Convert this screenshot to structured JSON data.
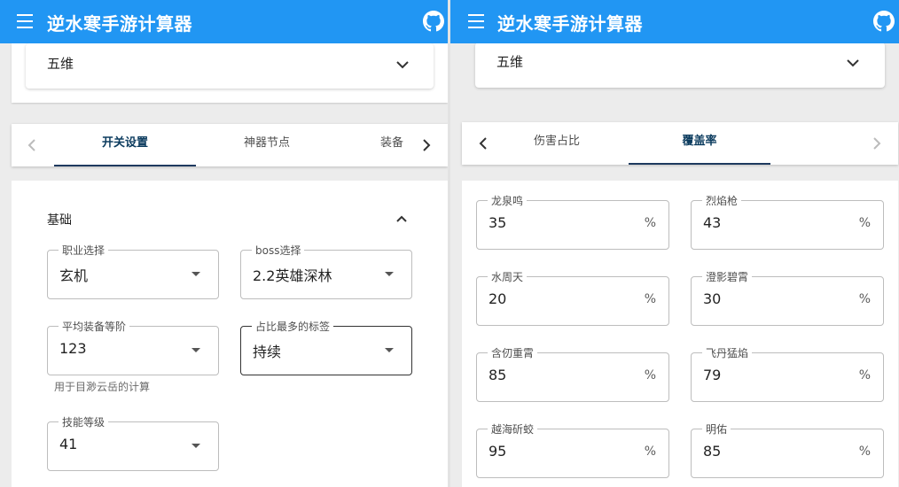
{
  "app": {
    "title": "逆水寒手游计算器"
  },
  "icons": {
    "menu": "menu-icon",
    "github": "github-icon",
    "chevron_down": "chevron-down-icon",
    "chevron_up": "chevron-up-icon",
    "chevron_left": "chevron-left-icon",
    "chevron_right": "chevron-right-icon",
    "dropdown": "dropdown-arrow-icon"
  },
  "colors": {
    "appbar": "#2196f3",
    "tab_active": "#0b3b5e"
  },
  "left": {
    "top_select": {
      "value": "五维"
    },
    "tabs": [
      {
        "label": "开关设置"
      },
      {
        "label": "神器节点"
      },
      {
        "label": "装备"
      }
    ],
    "section_title": "基础",
    "fields": {
      "profession": {
        "label": "职业选择",
        "value": "玄机"
      },
      "boss": {
        "label": "boss选择",
        "value": "2.2英雄深林"
      },
      "avg_gear": {
        "label": "平均装备等阶",
        "value": "123",
        "helper": "用于目渺云岳的计算"
      },
      "top_tag": {
        "label": "占比最多的标签",
        "value": "持续"
      },
      "skill_level": {
        "label": "技能等级",
        "value": "41"
      }
    }
  },
  "right": {
    "top_select": {
      "value": "五维"
    },
    "tabs": [
      {
        "label": "伤害占比"
      },
      {
        "label": "覆盖率"
      }
    ],
    "unit": "%",
    "fields": [
      {
        "label": "龙泉鸣",
        "value": "35"
      },
      {
        "label": "烈焰枪",
        "value": "43"
      },
      {
        "label": "水周天",
        "value": "20"
      },
      {
        "label": "澄影碧霄",
        "value": "30"
      },
      {
        "label": "含仞重霄",
        "value": "85"
      },
      {
        "label": "飞丹猛焰",
        "value": "79"
      },
      {
        "label": "越海斫蛟",
        "value": "95"
      },
      {
        "label": "明佑",
        "value": "85"
      }
    ]
  }
}
